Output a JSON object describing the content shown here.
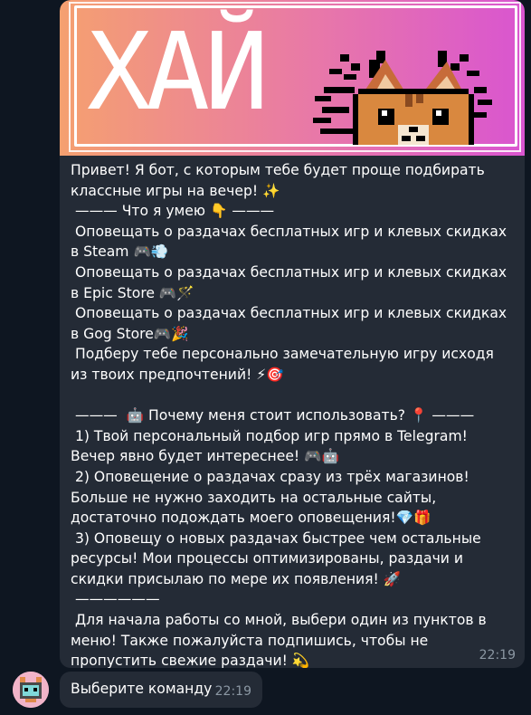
{
  "banner": {
    "title": "ХАЙ"
  },
  "message1": {
    "text": "Привет! Я бот, с которым тебе будет проще подбирать классные игры на вечер! ✨\n ——— Что я умею 👇 ———\n Оповещать о раздачах бесплатных игр и клевых скидках в Steam 🎮💨\n Оповещать о раздачах бесплатных игр и клевых скидках в Epic Store 🎮🪄\n Оповещать о раздачах бесплатных игр и клевых скидках в Gog Store🎮🎉\n Подберу тебе персонально замечательную игру исходя из твоих предпочтений! ⚡🎯\n\n ———  🤖 Почему меня стоит использовать? 📍 ———\n 1) Твой персональный подбор игр прямо в Telegram! Вечер явно будет интереснее! 🎮🤖\n 2) Оповещение о раздачах сразу из трёх магазинов! Больше не нужно заходить на остальные сайты, достаточно подождать моего оповещения!💎🎁\n 3) Оповещу о новых раздачах быстрее чем остальные ресурсы! Мои процессы оптимизированы, раздачи и скидки присылаю по мере их появления! 🚀\n ——————\n Для начала работы со мной, выбери один из пунктов в меню! Также пожалуйста подпишись, чтобы не пропустить свежие раздачи! 💫",
    "time": "22:19"
  },
  "message2": {
    "text": "Выберите команду",
    "time": "22:19"
  },
  "colors": {
    "background": "#0e1621",
    "bubble": "#242b36",
    "time": "#8b97a3",
    "banner_left": "#f5a070",
    "banner_right": "#d955d0"
  }
}
